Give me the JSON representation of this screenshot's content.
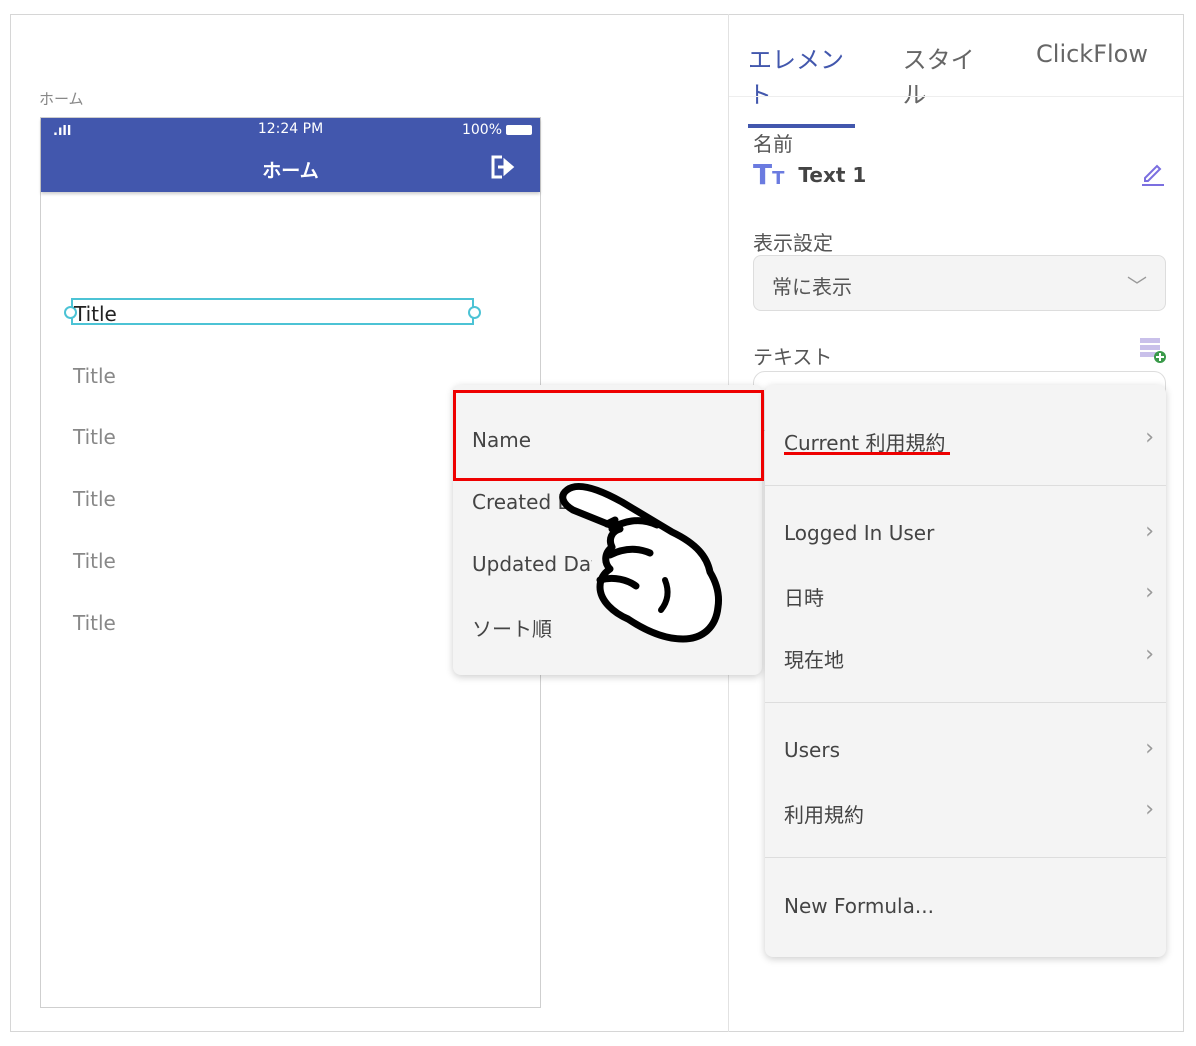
{
  "canvas": {
    "screen_label": "ホーム"
  },
  "phone": {
    "signal": ".ıll",
    "time": "12:24 PM",
    "battery": "100%",
    "title": "ホーム",
    "selected_text": "Title",
    "items": [
      "Title",
      "Title",
      "Title",
      "Title",
      "Title"
    ]
  },
  "panel": {
    "tabs": [
      "エレメント",
      "スタイル",
      "ClickFlow"
    ],
    "name_label": "名前",
    "name_value": "Text 1",
    "visibility_label": "表示設定",
    "visibility_value": "常に表示",
    "text_label": "テキスト"
  },
  "submenu": {
    "items": [
      "Name",
      "Created Date",
      "Updated Date",
      "ソート順"
    ]
  },
  "menu": {
    "items": [
      "Current 利用規約",
      "Logged In User",
      "日時",
      "現在地",
      "Users",
      "利用規約",
      "New Formula..."
    ]
  },
  "colors": {
    "accent": "#4257ad",
    "highlight": "#e00000",
    "selection": "#4cc3d5"
  }
}
